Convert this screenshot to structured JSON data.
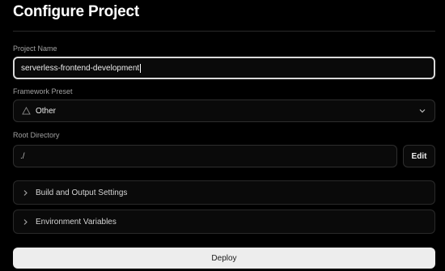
{
  "page": {
    "title": "Configure Project"
  },
  "project_name": {
    "label": "Project Name",
    "value": "serverless-frontend-development"
  },
  "framework_preset": {
    "label": "Framework Preset",
    "value": "Other",
    "icon": "triangle-icon"
  },
  "root_directory": {
    "label": "Root Directory",
    "value": "./",
    "edit_label": "Edit"
  },
  "sections": {
    "build_output": "Build and Output Settings",
    "env_vars": "Environment Variables"
  },
  "actions": {
    "deploy_label": "Deploy"
  },
  "colors": {
    "background": "#000000",
    "field_background": "#0a0a0a",
    "border": "#2e2e2e",
    "deploy_background": "#ededed"
  }
}
